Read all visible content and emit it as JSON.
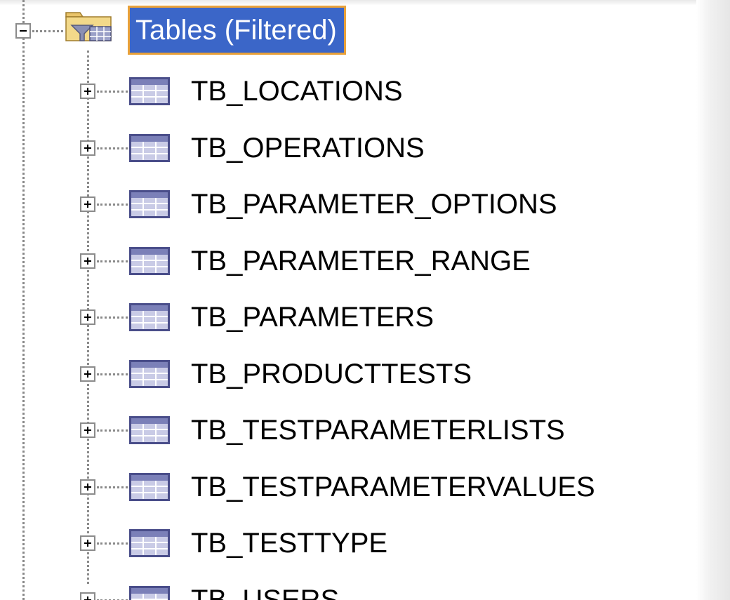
{
  "root": {
    "label": "Tables (Filtered)",
    "expanded": true,
    "icon": "filtered-folder-icon"
  },
  "tables": [
    {
      "name": "TB_LOCATIONS"
    },
    {
      "name": "TB_OPERATIONS"
    },
    {
      "name": "TB_PARAMETER_OPTIONS"
    },
    {
      "name": "TB_PARAMETER_RANGE"
    },
    {
      "name": "TB_PARAMETERS"
    },
    {
      "name": "TB_PRODUCTTESTS"
    },
    {
      "name": "TB_TESTPARAMETERLISTS"
    },
    {
      "name": "TB_TESTPARAMETERVALUES"
    },
    {
      "name": "TB_TESTTYPE"
    },
    {
      "name": "TB_USERS"
    }
  ],
  "icons": {
    "expander_collapsed": "plus-box-icon",
    "expander_expanded": "minus-box-icon",
    "table": "table-icon"
  },
  "colors": {
    "selection": "#3b66c8",
    "focus_border": "#e8a13a",
    "connector": "#8a8a8a"
  }
}
